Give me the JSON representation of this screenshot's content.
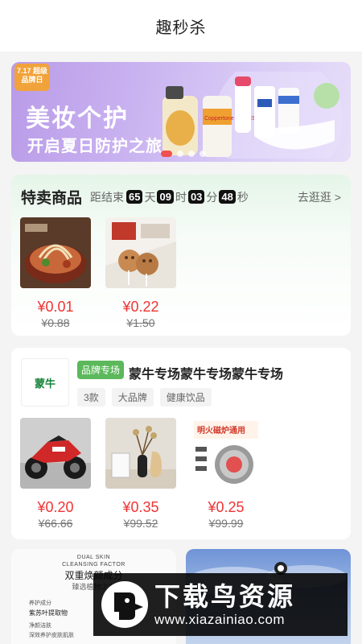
{
  "header": {
    "title": "趣秒杀"
  },
  "banner": {
    "badge": "7.17 超级品牌日",
    "title": "美妆个护",
    "subtitle": "开启夏日防护之旅",
    "product_label": "Coppertone BABIES",
    "dots": 4,
    "active_dot": 0
  },
  "flash_sale": {
    "title": "特卖商品",
    "countdown_label": "距结束",
    "countdown": {
      "days": "65",
      "days_unit": "天",
      "hours": "09",
      "hours_unit": "时",
      "minutes": "03",
      "minutes_unit": "分",
      "seconds": "48",
      "seconds_unit": "秒"
    },
    "more": "去逛逛 >",
    "products": [
      {
        "price": "¥0.01",
        "original": "¥0.88",
        "image": "noodle-bowl"
      },
      {
        "price": "¥0.22",
        "original": "¥1.50",
        "image": "bear-cookies"
      }
    ]
  },
  "brand": {
    "logo_text": "蒙牛",
    "tag": "品牌专场",
    "name": "蒙牛专场蒙牛专场蒙牛专场",
    "chips": [
      "3款",
      "大品牌",
      "健康饮品"
    ],
    "products": [
      {
        "price": "¥0.20",
        "original": "¥66.66",
        "image": "kids-motorbike"
      },
      {
        "price": "¥0.35",
        "original": "¥99.52",
        "image": "vase-decor"
      },
      {
        "price": "¥0.25",
        "original": "¥99.99",
        "image": "induction-pot",
        "label": "明火磁炉通用"
      }
    ]
  },
  "bottom_cards": {
    "left": {
      "line1": "DUAL SKIN",
      "line2": "CLEANSING FACTOR",
      "title": "双重焕颜成分",
      "subtitle": "臻选植物之力",
      "side1": "养护成分",
      "side2": "紫苏叶提取物",
      "side3": "净颜洁肤",
      "side4": "深效养护皮肤肌肤"
    }
  },
  "watermark": {
    "title": "下载鸟资源",
    "url": "www.xiazainiao.com"
  },
  "colors": {
    "price_red": "#ee3434",
    "brand_green": "#5bb85b",
    "banner_purple": "#c9b2f0"
  }
}
